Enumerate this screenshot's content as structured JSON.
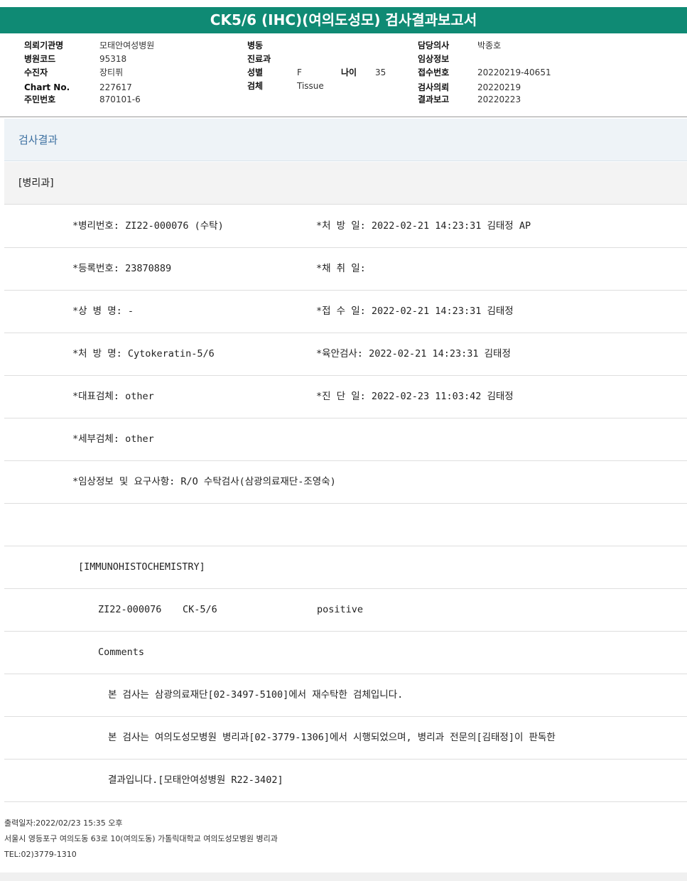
{
  "report": {
    "title": "CK5/6 (IHC)(여의도성모) 검사결과보고서"
  },
  "header": {
    "col1": [
      {
        "label": "의뢰기관명",
        "value": "모태안여성병원"
      },
      {
        "label": "병원코드",
        "value": "95318"
      },
      {
        "label": "수진자",
        "value": "장티퓌"
      },
      {
        "label": "Chart No.",
        "value": "227617"
      },
      {
        "label": "주민번호",
        "value": "870101-6"
      }
    ],
    "col2": [
      {
        "label": "병동",
        "value": ""
      },
      {
        "label": "진료과",
        "value": ""
      },
      {
        "label": "성별",
        "value": "F"
      },
      {
        "label": "검체",
        "value": "Tissue"
      }
    ],
    "age": {
      "label": "나이",
      "value": "35"
    },
    "col3": [
      {
        "label": "담당의사",
        "value": "박종호"
      },
      {
        "label": "임상정보",
        "value": ""
      },
      {
        "label": "접수번호",
        "value": "20220219-40651"
      },
      {
        "label": "검사의뢰",
        "value": "20220219"
      },
      {
        "label": "결과보고",
        "value": "20220223"
      }
    ]
  },
  "section": {
    "title": "검사결과",
    "department": "[병리과]"
  },
  "details": {
    "r1_left": "*병리번호: ZI22-000076 (수탁)",
    "r1_right": "*처 방 일: 2022-02-21 14:23:31  김태정 AP",
    "r2_left": "*등록번호: 23870889",
    "r2_right": "*채 취 일:",
    "r3_left": "*상 병 명: -",
    "r3_right": "*접 수 일: 2022-02-21 14:23:31  김태정",
    "r4_left": "*처 방 명: Cytokeratin-5/6",
    "r4_right": "*육안검사: 2022-02-21 14:23:31  김태정",
    "r5_left": "*대표검체: other",
    "r5_right": "*진 단 일: 2022-02-23 11:03:42  김태정",
    "r6_left": "*세부검체: other",
    "r7_left": "*임상정보 및 요구사항: R/O 수탁검사(삼광의료재단-조영숙)"
  },
  "ihc": {
    "heading": "[IMMUNOHISTOCHEMISTRY]",
    "specimen_id": "ZI22-000076",
    "marker": "CK-5/6",
    "result": "positive",
    "comments_label": "Comments",
    "comment1": "본 검사는 삼광의료재단[02-3497-5100]에서 재수탁한 검체입니다.",
    "comment2": "본 검사는 여의도성모병원 병리과[02-3779-1306]에서 시행되었으며, 병리과 전문의[김태정]이 판독한",
    "comment3": "결과입니다.[모태안여성병원 R22-3402]"
  },
  "footer": {
    "printed": "출력일자:2022/02/23 15:35 오후",
    "address": "서울시 영등포구 여의도동 63로 10(여의도동) 가톨릭대학교 여의도성모병원 병리과",
    "tel": "TEL:02)3779-1310"
  }
}
